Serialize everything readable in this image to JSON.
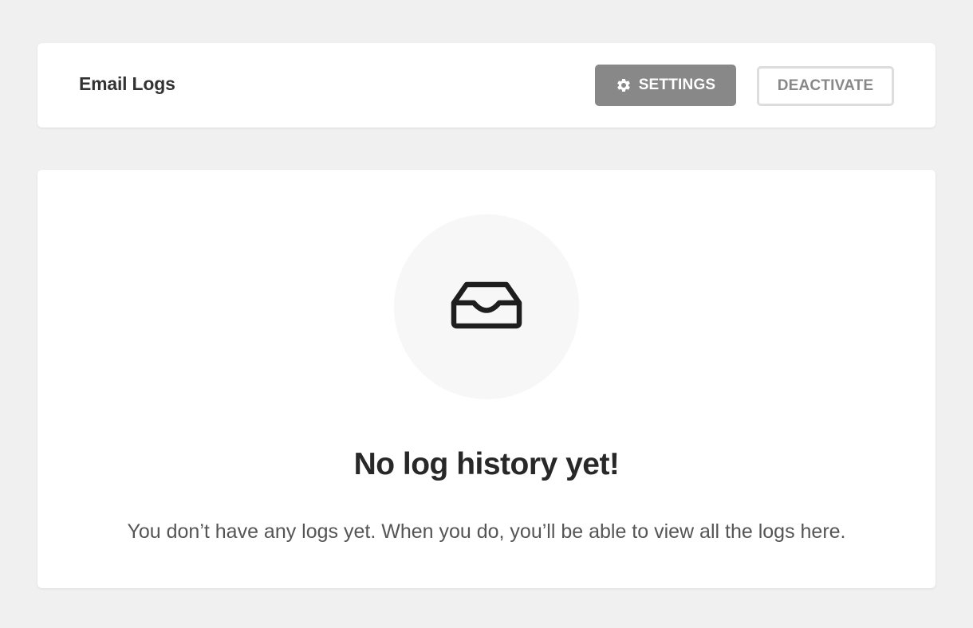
{
  "header": {
    "title": "Email Logs",
    "settings_label": "SETTINGS",
    "deactivate_label": "DEACTIVATE"
  },
  "empty_state": {
    "icon": "inbox-icon",
    "title": "No log history yet!",
    "description": "You don’t have any logs yet. When you do, you’ll be able to view all the logs here."
  },
  "colors": {
    "background": "#f0f0f0",
    "card": "#ffffff",
    "settings_button": "#888888",
    "deactivate_border": "#dddddd",
    "icon_circle": "#f7f7f7",
    "title_text": "#282828",
    "body_text": "#555555"
  }
}
